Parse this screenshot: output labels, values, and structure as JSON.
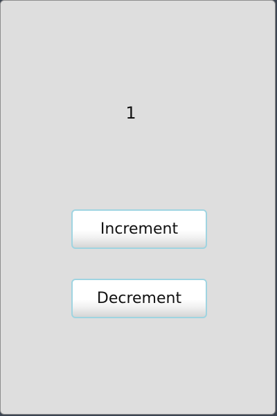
{
  "counter": {
    "value": "1"
  },
  "buttons": {
    "increment_label": "Increment",
    "decrement_label": "Decrement"
  },
  "colors": {
    "background": "#dedede",
    "button_border": "#9fd4e1",
    "text": "#111111"
  }
}
